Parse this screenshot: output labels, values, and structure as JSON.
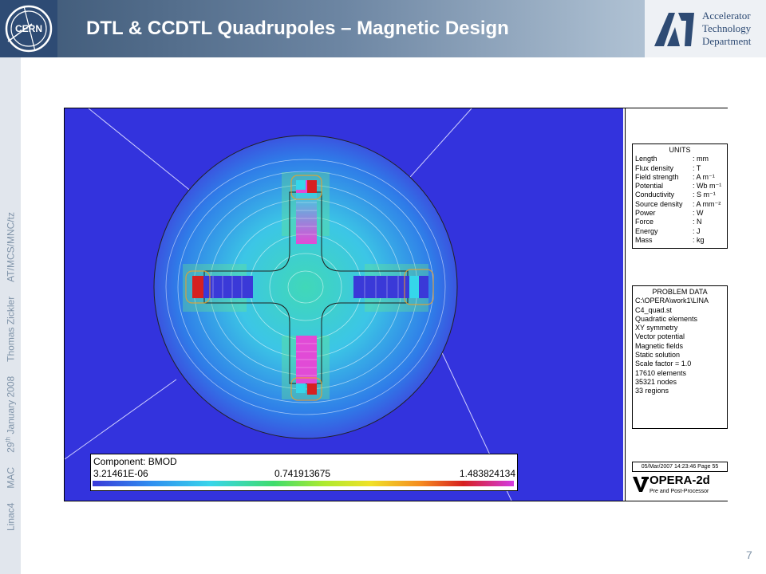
{
  "header": {
    "title": "DTL & CCDTL Quadrupoles – Magnetic Design",
    "cern_logo_text": "CERN",
    "atd_lines": [
      "Accelerator",
      "Technology",
      "Department"
    ]
  },
  "sidebar": {
    "items": [
      "Linac4",
      "MAC",
      "29",
      "th",
      " January 2008",
      "Thomas Zickler",
      "AT/MCS/MNC/tz"
    ]
  },
  "page_number": "7",
  "simulation": {
    "units": {
      "title": "UNITS",
      "rows": [
        {
          "quantity": "Length",
          "unit": ": mm"
        },
        {
          "quantity": "Flux density",
          "unit": ": T"
        },
        {
          "quantity": "Field strength",
          "unit": ": A m⁻¹"
        },
        {
          "quantity": "Potential",
          "unit": ": Wb m⁻¹"
        },
        {
          "quantity": "Conductivity",
          "unit": ": S m⁻¹"
        },
        {
          "quantity": "Source density",
          "unit": ": A mm⁻²"
        },
        {
          "quantity": "Power",
          "unit": ": W"
        },
        {
          "quantity": "Force",
          "unit": ": N"
        },
        {
          "quantity": "Energy",
          "unit": ": J"
        },
        {
          "quantity": "Mass",
          "unit": ": kg"
        }
      ]
    },
    "problem": {
      "title": "PROBLEM DATA",
      "lines": [
        "C:\\OPERA\\work1\\LINA",
        "C4_quad.st",
        "Quadratic elements",
        "XY symmetry",
        "Vector potential",
        "Magnetic fields",
        "Static solution",
        "Scale factor = 1.0",
        "17610 elements",
        "35321 nodes",
        "33 regions"
      ]
    },
    "timestamp": "05/Mar/2007 14:23:46 Page 55",
    "opera": {
      "name": "OPERA-2d",
      "subtitle": "Pre and Post-Processor"
    },
    "legend": {
      "component": "Component: BMOD",
      "min": "3.21461E-06",
      "mid": "0.741913675",
      "max": "1.483824134"
    }
  }
}
